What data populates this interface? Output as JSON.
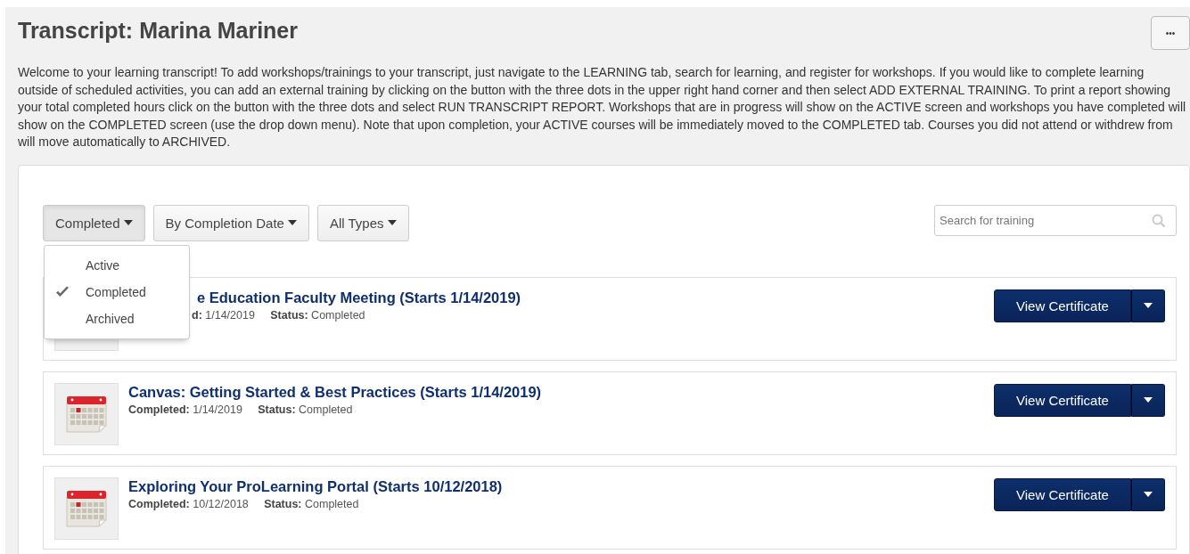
{
  "page": {
    "title": "Transcript: Marina Mariner",
    "intro": "Welcome to your learning transcript! To add workshops/trainings to your transcript, just navigate to the LEARNING tab, search for learning, and register for workshops. If you would like to complete learning outside of scheduled activities, you can add an external training by clicking on the button with the three dots in the upper right hand corner and then select ADD EXTERNAL TRAINING. To print a report showing your total completed hours click on the button with the three dots and select RUN TRANSCRIPT REPORT. Workshops that are in progress will show on the ACTIVE screen and workshops you have completed will show on the COMPLETED screen (use the drop down menu). Note that upon completion, your ACTIVE courses will be immediately moved to the COMPLETED tab. Courses you did not attend or withdrew from will move automatically to ARCHIVED.",
    "more_button": "•••"
  },
  "filters": [
    {
      "label": "Completed",
      "expanded": true
    },
    {
      "label": "By Completion Date",
      "expanded": false
    },
    {
      "label": "All Types",
      "expanded": false
    }
  ],
  "status_menu": [
    {
      "label": "Active",
      "selected": false
    },
    {
      "label": "Completed",
      "selected": true
    },
    {
      "label": "Archived",
      "selected": false
    }
  ],
  "search": {
    "placeholder": "Search for training"
  },
  "trainings": [
    {
      "title": "e Education Faculty Meeting (Starts 1/14/2019)",
      "completed_label": "d:",
      "completed_date": "1/14/2019",
      "status_label": "Status:",
      "status": "Completed",
      "button": "View Certificate",
      "covered": true
    },
    {
      "title": "Canvas: Getting Started & Best Practices (Starts 1/14/2019)",
      "completed_label": "Completed:",
      "completed_date": "1/14/2019",
      "status_label": "Status:",
      "status": "Completed",
      "button": "View Certificate",
      "covered": false
    },
    {
      "title": "Exploring Your ProLearning Portal (Starts 10/12/2018)",
      "completed_label": "Completed:",
      "completed_date": "10/12/2018",
      "status_label": "Status:",
      "status": "Completed",
      "button": "View Certificate",
      "covered": false
    }
  ]
}
